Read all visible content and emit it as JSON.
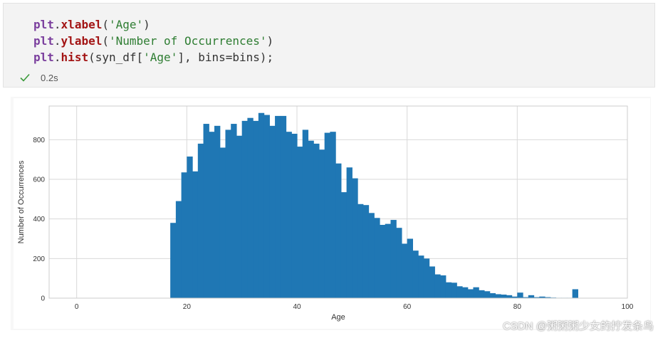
{
  "cell": {
    "code_lines": [
      [
        {
          "cls": "tok-kw",
          "text": "plt"
        },
        {
          "cls": "tok-punct",
          "text": "."
        },
        {
          "cls": "tok-fn",
          "text": "xlabel"
        },
        {
          "cls": "tok-punct",
          "text": "("
        },
        {
          "cls": "tok-str",
          "text": "'Age'"
        },
        {
          "cls": "tok-punct",
          "text": ")"
        }
      ],
      [
        {
          "cls": "tok-kw",
          "text": "plt"
        },
        {
          "cls": "tok-punct",
          "text": "."
        },
        {
          "cls": "tok-fn",
          "text": "ylabel"
        },
        {
          "cls": "tok-punct",
          "text": "("
        },
        {
          "cls": "tok-str",
          "text": "'Number of Occurrences'"
        },
        {
          "cls": "tok-punct",
          "text": ")"
        }
      ],
      [
        {
          "cls": "tok-kw",
          "text": "plt"
        },
        {
          "cls": "tok-punct",
          "text": "."
        },
        {
          "cls": "tok-fn",
          "text": "hist"
        },
        {
          "cls": "tok-punct",
          "text": "("
        },
        {
          "cls": "tok-plain",
          "text": "syn_df["
        },
        {
          "cls": "tok-str",
          "text": "'Age'"
        },
        {
          "cls": "tok-plain",
          "text": "], bins=bins"
        },
        {
          "cls": "tok-punct",
          "text": ");"
        }
      ]
    ],
    "exec_time": "0.2s",
    "status_icon": "check-icon",
    "status_color": "#3a9a3a"
  },
  "watermark": "CSDN @粥粥粥少女的拧发条鸟",
  "chart_data": {
    "type": "bar",
    "title": "",
    "xlabel": "Age",
    "ylabel": "Number of Occurrences",
    "xlim": [
      -5,
      100
    ],
    "ylim": [
      0,
      970
    ],
    "xticks": [
      0,
      20,
      40,
      60,
      80,
      100
    ],
    "yticks": [
      0,
      200,
      400,
      600,
      800
    ],
    "grid": true,
    "bar_color": "#1f77b4",
    "bin_width": 1,
    "bins": [
      {
        "x": 17,
        "value": 380
      },
      {
        "x": 18,
        "value": 490
      },
      {
        "x": 19,
        "value": 635
      },
      {
        "x": 20,
        "value": 715
      },
      {
        "x": 21,
        "value": 640
      },
      {
        "x": 22,
        "value": 780
      },
      {
        "x": 23,
        "value": 880
      },
      {
        "x": 24,
        "value": 840
      },
      {
        "x": 25,
        "value": 870
      },
      {
        "x": 26,
        "value": 760
      },
      {
        "x": 27,
        "value": 850
      },
      {
        "x": 28,
        "value": 880
      },
      {
        "x": 29,
        "value": 820
      },
      {
        "x": 30,
        "value": 895
      },
      {
        "x": 31,
        "value": 910
      },
      {
        "x": 32,
        "value": 895
      },
      {
        "x": 33,
        "value": 935
      },
      {
        "x": 34,
        "value": 925
      },
      {
        "x": 35,
        "value": 870
      },
      {
        "x": 36,
        "value": 920
      },
      {
        "x": 37,
        "value": 920
      },
      {
        "x": 38,
        "value": 840
      },
      {
        "x": 39,
        "value": 830
      },
      {
        "x": 40,
        "value": 765
      },
      {
        "x": 41,
        "value": 850
      },
      {
        "x": 42,
        "value": 795
      },
      {
        "x": 43,
        "value": 780
      },
      {
        "x": 44,
        "value": 750
      },
      {
        "x": 45,
        "value": 835
      },
      {
        "x": 46,
        "value": 840
      },
      {
        "x": 47,
        "value": 680
      },
      {
        "x": 48,
        "value": 535
      },
      {
        "x": 49,
        "value": 660
      },
      {
        "x": 50,
        "value": 605
      },
      {
        "x": 51,
        "value": 475
      },
      {
        "x": 52,
        "value": 470
      },
      {
        "x": 53,
        "value": 430
      },
      {
        "x": 54,
        "value": 405
      },
      {
        "x": 55,
        "value": 370
      },
      {
        "x": 56,
        "value": 375
      },
      {
        "x": 57,
        "value": 395
      },
      {
        "x": 58,
        "value": 355
      },
      {
        "x": 59,
        "value": 275
      },
      {
        "x": 60,
        "value": 300
      },
      {
        "x": 61,
        "value": 240
      },
      {
        "x": 62,
        "value": 215
      },
      {
        "x": 63,
        "value": 200
      },
      {
        "x": 64,
        "value": 160
      },
      {
        "x": 65,
        "value": 120
      },
      {
        "x": 66,
        "value": 115
      },
      {
        "x": 67,
        "value": 80
      },
      {
        "x": 68,
        "value": 78
      },
      {
        "x": 69,
        "value": 60
      },
      {
        "x": 70,
        "value": 55
      },
      {
        "x": 71,
        "value": 45
      },
      {
        "x": 72,
        "value": 55
      },
      {
        "x": 73,
        "value": 40
      },
      {
        "x": 74,
        "value": 35
      },
      {
        "x": 75,
        "value": 25
      },
      {
        "x": 76,
        "value": 20
      },
      {
        "x": 77,
        "value": 18
      },
      {
        "x": 78,
        "value": 15
      },
      {
        "x": 79,
        "value": 8
      },
      {
        "x": 80,
        "value": 28
      },
      {
        "x": 81,
        "value": 5
      },
      {
        "x": 82,
        "value": 15
      },
      {
        "x": 83,
        "value": 5
      },
      {
        "x": 84,
        "value": 8
      },
      {
        "x": 85,
        "value": 5
      },
      {
        "x": 86,
        "value": 3
      },
      {
        "x": 87,
        "value": 2
      },
      {
        "x": 88,
        "value": 2
      },
      {
        "x": 89,
        "value": 2
      },
      {
        "x": 90,
        "value": 45
      }
    ]
  }
}
